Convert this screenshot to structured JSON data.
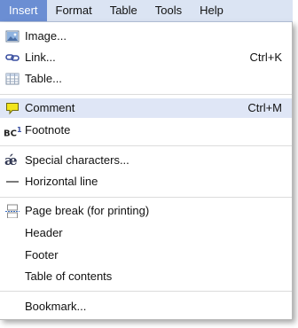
{
  "menubar": {
    "items": [
      {
        "label": "Insert",
        "active": true
      },
      {
        "label": "Format"
      },
      {
        "label": "Table"
      },
      {
        "label": "Tools"
      },
      {
        "label": "Help"
      }
    ]
  },
  "menu": {
    "image": {
      "label": "Image...",
      "icon": "image-icon"
    },
    "link": {
      "label": "Link...",
      "shortcut": "Ctrl+K",
      "icon": "link-icon"
    },
    "table": {
      "label": "Table...",
      "icon": "table-icon"
    },
    "comment": {
      "label": "Comment",
      "shortcut": "Ctrl+M",
      "icon": "comment-icon",
      "highlighted": true
    },
    "footnote": {
      "label": "Footnote",
      "icon": "footnote-icon",
      "icon_text": "BC"
    },
    "special_characters": {
      "label": "Special characters...",
      "icon": "special-characters-icon",
      "icon_text": "ǽ"
    },
    "horizontal_line": {
      "label": "Horizontal line",
      "icon": "horizontal-line-icon"
    },
    "page_break": {
      "label": "Page break (for printing)",
      "icon": "page-break-icon"
    },
    "header": {
      "label": "Header"
    },
    "footer": {
      "label": "Footer"
    },
    "table_of_contents": {
      "label": "Table of contents"
    },
    "bookmark": {
      "label": "Bookmark..."
    }
  },
  "colors": {
    "menubar_bg": "#dbe4f3",
    "active_menu_bg": "#6b8ed3",
    "highlight_bg": "#dfe6f6",
    "comment_icon": "#f2e51b"
  }
}
